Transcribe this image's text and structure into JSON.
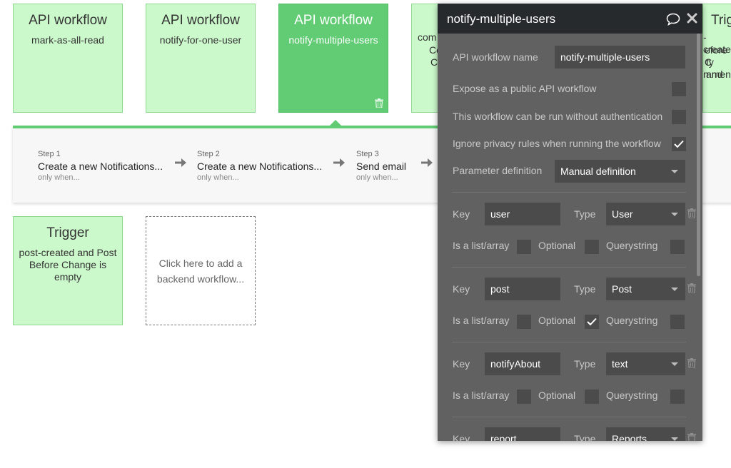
{
  "cards": [
    {
      "title": "API workflow",
      "subtitle": "mark-as-all-read"
    },
    {
      "title": "API workflow",
      "subtitle": "notify-for-one-user"
    },
    {
      "title": "API workflow",
      "subtitle": "notify-multiple-users"
    },
    {
      "lines": [
        "com",
        "Co",
        "Cl"
      ]
    },
    {
      "title": "Trig",
      "lines": [
        "-create",
        "efore C",
        "ty and",
        "mment"
      ]
    }
  ],
  "trigger_card": {
    "title": "Trigger",
    "subtitle": "post-created and Post Before Change is empty"
  },
  "add_card": {
    "text": "Click here to add a backend workflow..."
  },
  "steps": [
    {
      "label": "Step 1",
      "name": "Create a new Notifications...",
      "cond": "only when..."
    },
    {
      "label": "Step 2",
      "name": "Create a new Notifications...",
      "cond": "only when..."
    },
    {
      "label": "Step 3",
      "name": "Send email",
      "cond": "only when..."
    }
  ],
  "panel": {
    "title": "notify-multiple-users",
    "workflow_name_label": "API workflow name",
    "workflow_name_value": "notify-multiple-users",
    "expose_label": "Expose as a public API workflow",
    "expose_checked": false,
    "noauth_label": "This workflow can be run without authentication",
    "noauth_checked": false,
    "privacy_label": "Ignore privacy rules when running the workflow",
    "privacy_checked": true,
    "param_def_label": "Parameter definition",
    "param_def_value": "Manual definition",
    "key_label": "Key",
    "type_label": "Type",
    "list_label": "Is a list/array",
    "optional_label": "Optional",
    "querystring_label": "Querystring",
    "params": [
      {
        "key": "user",
        "type": "User",
        "list": false,
        "optional": false,
        "querystring": false
      },
      {
        "key": "post",
        "type": "Post",
        "list": false,
        "optional": true,
        "querystring": false
      },
      {
        "key": "notifyAbout",
        "type": "text",
        "list": false,
        "optional": false,
        "querystring": false
      },
      {
        "key": "report",
        "type": "Reports"
      }
    ]
  }
}
